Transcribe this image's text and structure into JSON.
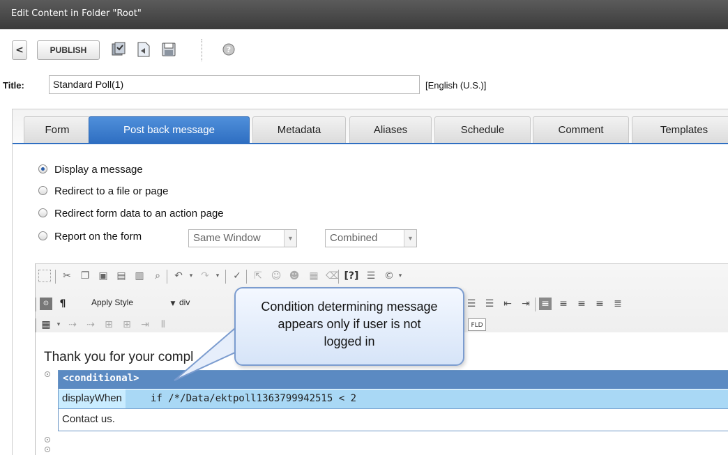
{
  "window": {
    "title": "Edit Content in Folder \"Root\""
  },
  "toolbar": {
    "publish_label": "PUBLISH",
    "back_glyph": "<",
    "icons": [
      "back-icon",
      "checkin-icon",
      "preview-icon",
      "save-icon",
      "help-icon"
    ]
  },
  "title_row": {
    "label": "Title:",
    "value": "Standard Poll(1)",
    "language": "[English (U.S.)]"
  },
  "tabs": [
    {
      "label": "Form",
      "active": false
    },
    {
      "label": "Post back message",
      "active": true
    },
    {
      "label": "Metadata",
      "active": false
    },
    {
      "label": "Aliases",
      "active": false
    },
    {
      "label": "Schedule",
      "active": false
    },
    {
      "label": "Comment",
      "active": false
    },
    {
      "label": "Templates",
      "active": false
    }
  ],
  "options": [
    {
      "label": "Display a message",
      "checked": true
    },
    {
      "label": "Redirect to a file or page",
      "checked": false
    },
    {
      "label": "Redirect form data to an action page",
      "checked": false
    },
    {
      "label": "Report on the form",
      "checked": false
    }
  ],
  "report_selects": {
    "window": "Same Window",
    "mode": "Combined"
  },
  "editor": {
    "apply_style": "Apply Style",
    "block_format": "div",
    "field_button": "FLD",
    "body_text": "Thank you for your compl",
    "conditional_tag": "<conditional>",
    "attribute_name": "displayWhen",
    "attribute_value": "if /*/Data/ektpoll1363799942515 < 2",
    "conditional_content": "Contact us."
  },
  "callout": {
    "line1": "Condition determining message",
    "line2": "appears only if user is not",
    "line3": "logged in"
  },
  "colors": {
    "accent": "#2f6fc2",
    "titlebar": "#4a4a4a",
    "conditional_header": "#5b8ac2",
    "attribute_row": "#a9d8f5"
  }
}
